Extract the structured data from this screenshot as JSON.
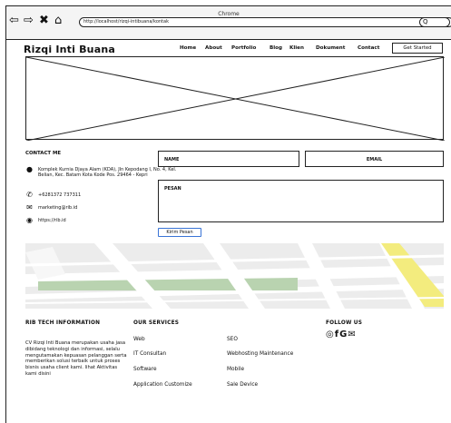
{
  "browser": {
    "title": "Chrome",
    "url": "http://localhost/rizqi-intibuana/kontak",
    "back_icon": "arrow-left-icon",
    "forward_icon": "arrow-right-icon",
    "close_icon": "close-icon",
    "home_icon": "home-icon",
    "search_icon": "search-icon"
  },
  "header": {
    "brand": "Rizqi Inti Buana",
    "menu": [
      "Home",
      "About",
      "Portfolio",
      "Blog",
      "Klien",
      "Dokument",
      "Contact"
    ],
    "cta": "Get Started"
  },
  "contact": {
    "title": "CONTACT ME",
    "address": "Komplek Kurnia Djaya Alam (KDA), Jln Kepodang I, No. 4, Kel. Belian, Kec. Batam Kota Kode Pos. 29464 - Kepri",
    "phone": "+6281372 737311",
    "email": "marketing@rib.id",
    "website": "https://rib.id",
    "icons": [
      "location-pin-icon",
      "phone-icon",
      "mail-icon",
      "globe-icon"
    ]
  },
  "form": {
    "name_label": "NAME",
    "email_label": "EMAIL",
    "message_label": "PESAN",
    "submit": "Kirim Pesan"
  },
  "footer": {
    "company_title": "RIB TECH INFORMATION",
    "company_desc": "CV Rizqi Inti Buana merupakan usaha jasa dibidang teknologi dan informasi, selalu mengutamakan kepuasan pelanggan serta memberikan solusi terbaik untuk proses bisnis usaha client kami. lihat Aktivitas kami disini",
    "services_title": "OUR SERVICES",
    "services": [
      "Web",
      "SEO",
      "IT Consultan",
      "Webhosting Maintenance",
      "Software",
      "Mobile",
      "Application Customize",
      "Sale Device"
    ],
    "follow_title": "FOLLOW US",
    "social_icons": [
      "instagram-icon",
      "facebook-icon",
      "google-icon",
      "mail-icon"
    ]
  },
  "colors": {
    "map_road": "#ffffff",
    "map_green": "#b9d3b0",
    "map_yellow": "#f3ec7e",
    "button_border": "#3a74d6"
  }
}
